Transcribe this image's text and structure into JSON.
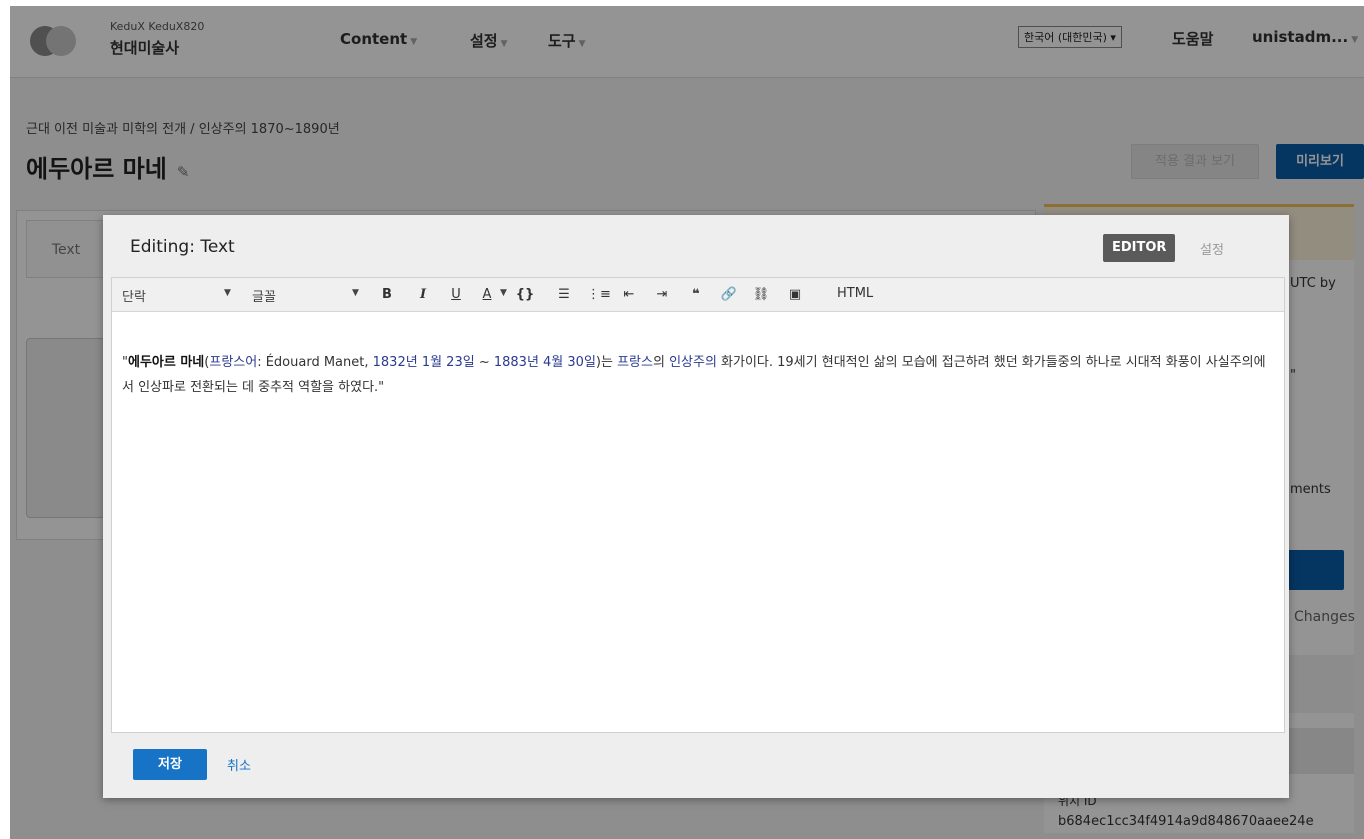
{
  "header": {
    "course_org": "KeduX KeduX820",
    "course_name": "현대미술사",
    "nav": [
      {
        "label": "Content"
      },
      {
        "label": "설정"
      },
      {
        "label": "도구"
      }
    ],
    "language": "한국어 (대한민국) ▾",
    "help": "도움말",
    "user": "unistadm..."
  },
  "page": {
    "breadcrumb": "근대 이전 미술과 미학의 전개  /  인상주의 1870~1890년",
    "title": "에두아르 마네",
    "view_live_label": "적용 결과 보기",
    "preview_label": "미리보기"
  },
  "background": {
    "tab_label": "Text",
    "sidebar_fragments": {
      "utc": "UTC by",
      "quote": "\"",
      "comments": "ments",
      "changes": "Changes"
    },
    "location_label": "위치 ID",
    "location_id": "b684ec1cc34f4914a9d848670aaee24e"
  },
  "modal": {
    "title": "Editing: Text",
    "mode_editor": "EDITOR",
    "mode_settings": "설정",
    "toolbar": {
      "paragraph": "단락",
      "font": "글꼴",
      "bold": "B",
      "italic": "I",
      "underline": "U",
      "text_color": "A",
      "code": "{}",
      "html": "HTML"
    },
    "content": {
      "open_quote": "\"",
      "name_bold": "에두아르 마네",
      "paren_open": "(",
      "lang_link": "프랑스어",
      "colon": ": ",
      "french_name": "Édouard Manet",
      "comma": ", ",
      "birth_link": "1832년 1월 23일",
      "tilde": " ~ ",
      "death_link": "1883년 4월 30일",
      "paren_close": ")는 ",
      "country_link": "프랑스",
      "possessive": "의 ",
      "movement_link": "인상주의",
      "rest": " 화가이다. 19세기 현대적인 삶의 모습에 접근하려 했던 화가들중의 하나로 시대적 화풍이 사실주의에서 인상파로 전환되는 데 중추적 역할을 하였다.\""
    },
    "save_label": "저장",
    "cancel_label": "취소"
  }
}
